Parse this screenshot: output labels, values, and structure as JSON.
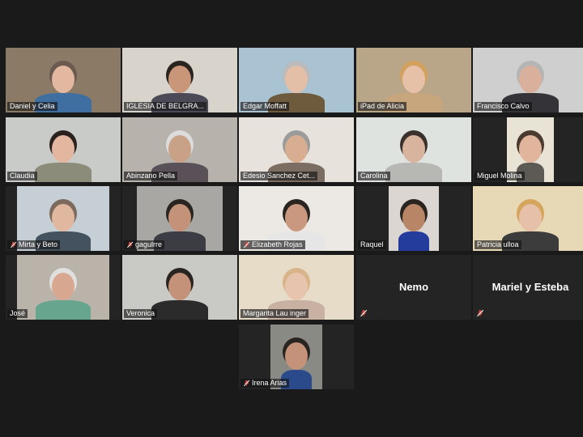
{
  "meeting": {
    "participants": [
      {
        "name": "Daniel y Celia",
        "muted": false
      },
      {
        "name": "IGLESIA DE BELGRA...",
        "muted": false
      },
      {
        "name": "Edgar Moffatt",
        "muted": false
      },
      {
        "name": "iPad de Alicia",
        "muted": false
      },
      {
        "name": "Francisco Calvo",
        "muted": false
      },
      {
        "name": "Claudia",
        "muted": false
      },
      {
        "name": "Abinzano Pella",
        "muted": false
      },
      {
        "name": "Edesio Sanchez Cet...",
        "muted": false
      },
      {
        "name": "Carolina",
        "muted": false
      },
      {
        "name": "Miguel Molina",
        "muted": false
      },
      {
        "name": "Mirta y Beto",
        "muted": true
      },
      {
        "name": "gagulrre",
        "muted": true
      },
      {
        "name": "Elizabeth Rojas",
        "muted": true
      },
      {
        "name": "Raquel",
        "muted": false
      },
      {
        "name": "Patricia ulloa",
        "muted": false
      },
      {
        "name": "José",
        "muted": false
      },
      {
        "name": "Veronica",
        "muted": false
      },
      {
        "name": "Margarita Lau inger",
        "muted": false,
        "speaking": true
      },
      {
        "name": "Nemo",
        "muted": true,
        "video_off": true
      },
      {
        "name": "Mariel y Esteba",
        "muted": true,
        "video_off": true
      },
      {
        "name": "Irena Arias",
        "muted": true
      }
    ]
  },
  "colors": {
    "background": "#1a1a1a",
    "tile": "#242424",
    "active_speaker_border": "#d7e34a",
    "mute_icon": "#e0483e"
  }
}
